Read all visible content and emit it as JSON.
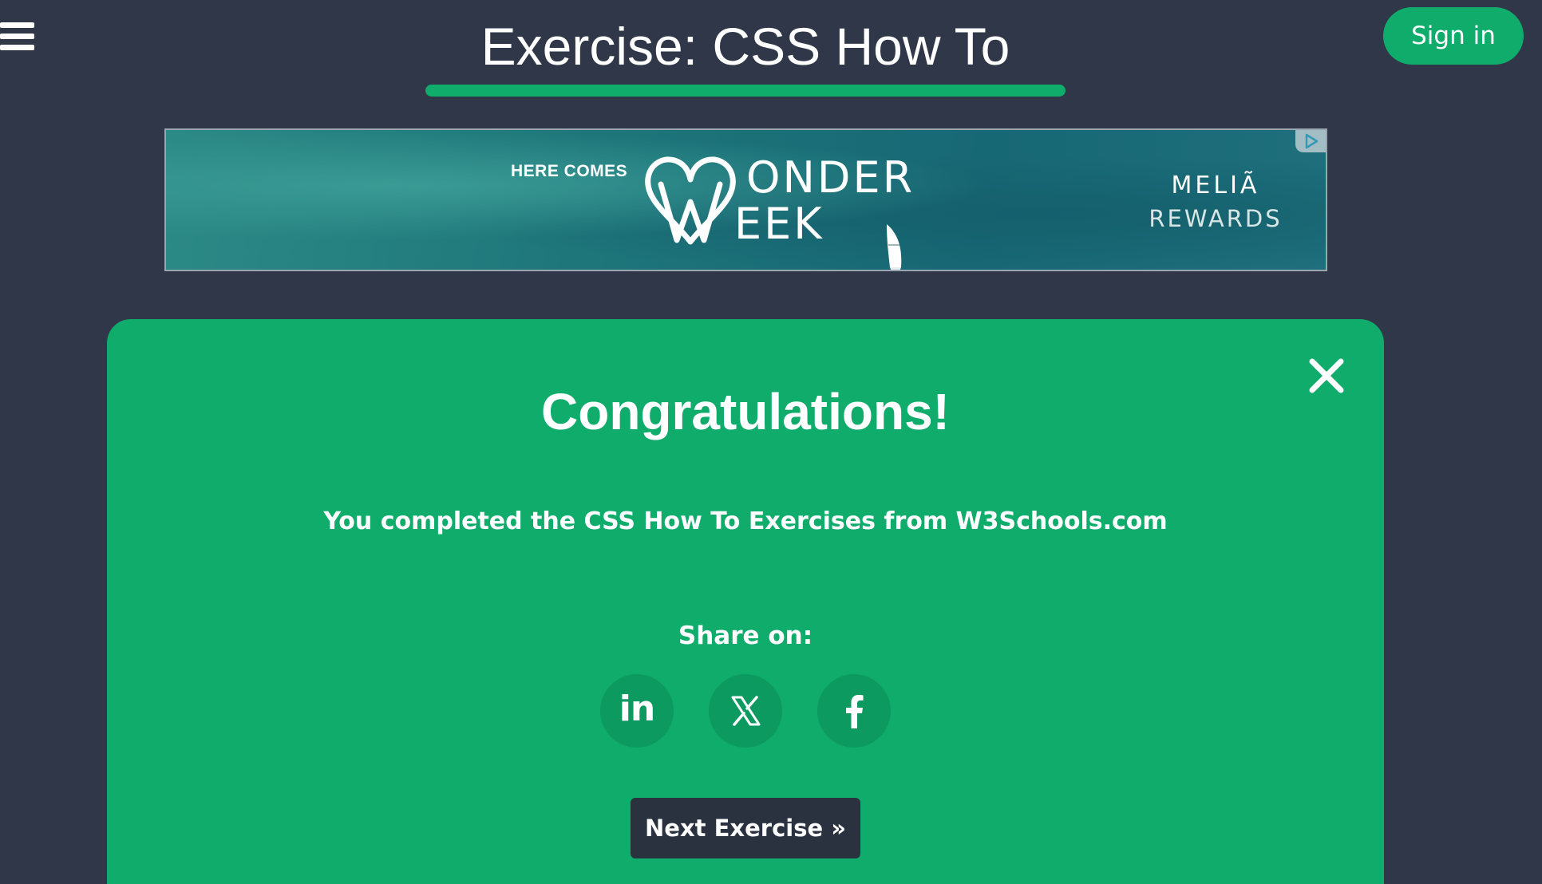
{
  "header": {
    "title": "Exercise: CSS How To",
    "progress_fraction": 1.0,
    "sign_in_label": "Sign in",
    "menu_icon": "hamburger-menu-icon"
  },
  "ad": {
    "tagline": "HERE COMES",
    "logo_line1": "ONDER",
    "logo_line2": "EEK",
    "brand_line1": "MELIÃ",
    "brand_line2": "REWARDS",
    "choices_icon": "ad-choices-icon"
  },
  "modal": {
    "heading": "Congratulations!",
    "message": "You completed the CSS How To Exercises from W3Schools.com",
    "share_label": "Share on:",
    "share": {
      "linkedin_glyph": "in",
      "x_icon": "x-logo-icon",
      "facebook_icon": "facebook-icon"
    },
    "next_label": "Next Exercise »",
    "close_icon": "close-icon"
  },
  "colors": {
    "background": "#2f3748",
    "accent_green": "#10ac6c",
    "share_circle": "#0c9a60",
    "next_button": "#2a3240"
  }
}
